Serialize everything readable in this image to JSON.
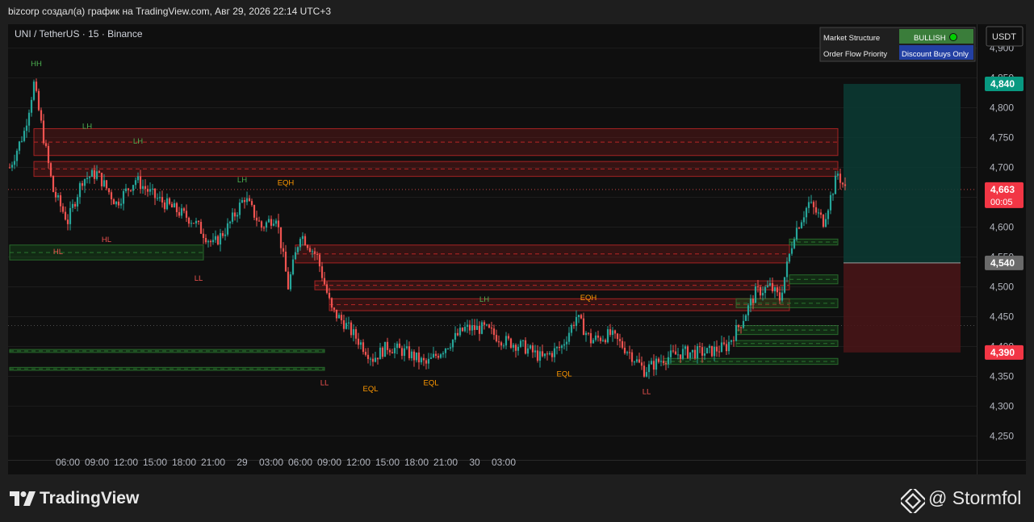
{
  "header": {
    "title": "bizcorp создал(а) график на TradingView.com, Авг 29, 2026 22:14 UTC+3"
  },
  "symbol": {
    "label": "UNI / TetherUS · 15 · Binance"
  },
  "currency_button": "USDT",
  "status_table": {
    "rows": [
      {
        "label": "Market Structure",
        "value": "BULLISH",
        "color": "#3a7d3a"
      },
      {
        "label": "Order Flow Priority",
        "value": "Discount Buys Only",
        "color": "#2340a3"
      }
    ]
  },
  "price_tags": {
    "target": {
      "value": "4,840",
      "color": "#089981"
    },
    "current": {
      "value": "4,663",
      "timer": "00:05",
      "color": "#f23645"
    },
    "entry": {
      "value": "4,540",
      "color": "#6a6a6a"
    },
    "stop": {
      "value": "4,390",
      "color": "#f23645"
    }
  },
  "footer": {
    "brand": "TradingView",
    "author": "@ Stormfol"
  },
  "colors": {
    "up": "#26a69a",
    "down": "#ef5350",
    "bull_zone": "#1b5e20",
    "bear_zone": "#7f1d1d"
  },
  "icons": {
    "brand": "tradingview-logo-icon",
    "author": "binance-diamond-icon"
  },
  "chart_data": {
    "type": "candlestick",
    "y_axis": {
      "ticks": [
        4.25,
        4.3,
        4.35,
        4.4,
        4.45,
        4.5,
        4.55,
        4.6,
        4.65,
        4.7,
        4.75,
        4.8,
        4.85,
        4.9
      ],
      "tick_labels": [
        "4,250",
        "4,300",
        "4,350",
        "4,400",
        "4,450",
        "4,500",
        "4,550",
        "4,600",
        "4,650",
        "4,700",
        "4,750",
        "4,800",
        "4,850",
        "4,900"
      ],
      "range": [
        4.21,
        4.94
      ]
    },
    "x_axis": {
      "labels": [
        "06:00",
        "09:00",
        "12:00",
        "15:00",
        "18:00",
        "21:00",
        "29",
        "03:00",
        "06:00",
        "09:00",
        "12:00",
        "15:00",
        "18:00",
        "21:00",
        "30",
        "03:00"
      ],
      "bar_minutes": 15
    },
    "ohlc_anchors": [
      {
        "i": 0,
        "price": 4.7
      },
      {
        "i": 6,
        "price": 4.76
      },
      {
        "i": 10,
        "price": 4.84
      },
      {
        "i": 18,
        "price": 4.66
      },
      {
        "i": 24,
        "price": 4.61
      },
      {
        "i": 30,
        "price": 4.68
      },
      {
        "i": 36,
        "price": 4.69
      },
      {
        "i": 44,
        "price": 4.64
      },
      {
        "i": 52,
        "price": 4.68
      },
      {
        "i": 60,
        "price": 4.65
      },
      {
        "i": 68,
        "price": 4.63
      },
      {
        "i": 76,
        "price": 4.61
      },
      {
        "i": 84,
        "price": 4.57
      },
      {
        "i": 90,
        "price": 4.6
      },
      {
        "i": 97,
        "price": 4.65
      },
      {
        "i": 104,
        "price": 4.6
      },
      {
        "i": 110,
        "price": 4.62
      },
      {
        "i": 115,
        "price": 4.5
      },
      {
        "i": 120,
        "price": 4.59
      },
      {
        "i": 127,
        "price": 4.55
      },
      {
        "i": 133,
        "price": 4.46
      },
      {
        "i": 138,
        "price": 4.44
      },
      {
        "i": 144,
        "price": 4.41
      },
      {
        "i": 150,
        "price": 4.38
      },
      {
        "i": 156,
        "price": 4.4
      },
      {
        "i": 164,
        "price": 4.39
      },
      {
        "i": 172,
        "price": 4.37
      },
      {
        "i": 180,
        "price": 4.4
      },
      {
        "i": 188,
        "price": 4.43
      },
      {
        "i": 196,
        "price": 4.43
      },
      {
        "i": 204,
        "price": 4.41
      },
      {
        "i": 212,
        "price": 4.4
      },
      {
        "i": 220,
        "price": 4.38
      },
      {
        "i": 228,
        "price": 4.4
      },
      {
        "i": 234,
        "price": 4.45
      },
      {
        "i": 240,
        "price": 4.41
      },
      {
        "i": 248,
        "price": 4.42
      },
      {
        "i": 256,
        "price": 4.39
      },
      {
        "i": 262,
        "price": 4.36
      },
      {
        "i": 270,
        "price": 4.38
      },
      {
        "i": 278,
        "price": 4.39
      },
      {
        "i": 288,
        "price": 4.39
      },
      {
        "i": 296,
        "price": 4.4
      },
      {
        "i": 302,
        "price": 4.44
      },
      {
        "i": 308,
        "price": 4.49
      },
      {
        "i": 314,
        "price": 4.5
      },
      {
        "i": 318,
        "price": 4.48
      },
      {
        "i": 324,
        "price": 4.59
      },
      {
        "i": 330,
        "price": 4.64
      },
      {
        "i": 336,
        "price": 4.61
      },
      {
        "i": 342,
        "price": 4.69
      },
      {
        "i": 345,
        "price": 4.663
      }
    ],
    "zones": [
      {
        "type": "bear",
        "from_i": 10,
        "to_i": 345,
        "top": 4.765,
        "bottom": 4.72
      },
      {
        "type": "bear",
        "from_i": 10,
        "to_i": 345,
        "top": 4.71,
        "bottom": 4.685
      },
      {
        "type": "bull",
        "from_i": 0,
        "to_i": 80,
        "top": 4.57,
        "bottom": 4.545
      },
      {
        "type": "bear",
        "from_i": 118,
        "to_i": 322,
        "top": 4.57,
        "bottom": 4.54
      },
      {
        "type": "bear",
        "from_i": 126,
        "to_i": 322,
        "top": 4.51,
        "bottom": 4.495
      },
      {
        "type": "bear",
        "from_i": 132,
        "to_i": 322,
        "top": 4.48,
        "bottom": 4.46
      },
      {
        "type": "bull",
        "from_i": 0,
        "to_i": 130,
        "top": 4.395,
        "bottom": 4.39
      },
      {
        "type": "bull",
        "from_i": 0,
        "to_i": 130,
        "top": 4.365,
        "bottom": 4.36
      },
      {
        "type": "bull",
        "from_i": 322,
        "to_i": 345,
        "top": 4.58,
        "bottom": 4.57
      },
      {
        "type": "bull",
        "from_i": 322,
        "to_i": 345,
        "top": 4.52,
        "bottom": 4.505
      },
      {
        "type": "bull",
        "from_i": 300,
        "to_i": 345,
        "top": 4.48,
        "bottom": 4.465
      },
      {
        "type": "bull",
        "from_i": 300,
        "to_i": 345,
        "top": 4.435,
        "bottom": 4.42
      },
      {
        "type": "bull",
        "from_i": 300,
        "to_i": 345,
        "top": 4.41,
        "bottom": 4.4
      },
      {
        "type": "bull",
        "from_i": 270,
        "to_i": 345,
        "top": 4.38,
        "bottom": 4.37
      }
    ],
    "position": {
      "entry": 4.54,
      "target": 4.84,
      "stop": 4.39
    },
    "labels": [
      {
        "text": "HH",
        "i": 11,
        "price": 4.87,
        "kind": "bull"
      },
      {
        "text": "LH",
        "i": 32,
        "price": 4.765,
        "kind": "bull"
      },
      {
        "text": "LH",
        "i": 53,
        "price": 4.74,
        "kind": "bull"
      },
      {
        "text": "HL",
        "i": 20,
        "price": 4.555,
        "kind": "bear"
      },
      {
        "text": "HL",
        "i": 40,
        "price": 4.575,
        "kind": "bear"
      },
      {
        "text": "LL",
        "i": 78,
        "price": 4.51,
        "kind": "bear"
      },
      {
        "text": "LH",
        "i": 96,
        "price": 4.675,
        "kind": "bull"
      },
      {
        "text": "EQH",
        "i": 114,
        "price": 4.67,
        "kind": "eq"
      },
      {
        "text": "LL",
        "i": 130,
        "price": 4.335,
        "kind": "bear"
      },
      {
        "text": "EQL",
        "i": 149,
        "price": 4.325,
        "kind": "eq"
      },
      {
        "text": "EQL",
        "i": 174,
        "price": 4.335,
        "kind": "eq"
      },
      {
        "text": "LH",
        "i": 196,
        "price": 4.475,
        "kind": "bull"
      },
      {
        "text": "EQL",
        "i": 229,
        "price": 4.35,
        "kind": "eq"
      },
      {
        "text": "EQH",
        "i": 239,
        "price": 4.478,
        "kind": "eq"
      },
      {
        "text": "LL",
        "i": 263,
        "price": 4.32,
        "kind": "bear"
      }
    ]
  }
}
